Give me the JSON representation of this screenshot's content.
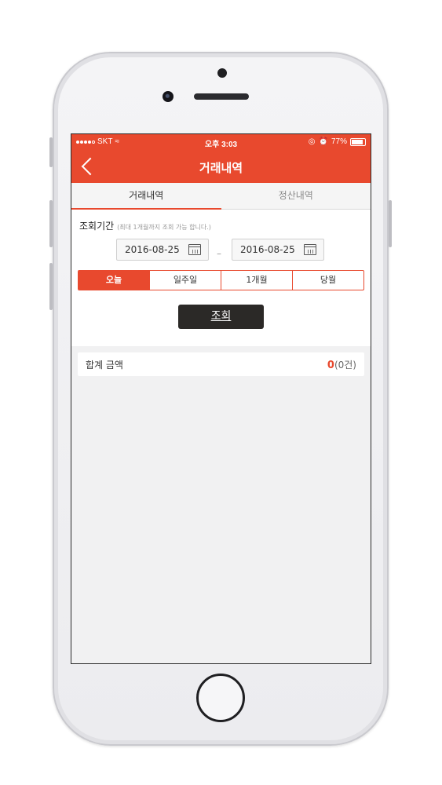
{
  "status_bar": {
    "carrier": "SKT",
    "time": "오후 3:03",
    "battery": "77%",
    "battery_fraction": 0.77
  },
  "nav": {
    "title": "거래내역",
    "back_icon": "chevron-left-icon"
  },
  "tabs": [
    {
      "label": "거래내역",
      "active": true
    },
    {
      "label": "정산내역",
      "active": false
    }
  ],
  "period": {
    "label": "조회기간",
    "note": "(최대 1개월까지 조회 가능 합니다.)",
    "start_date": "2016-08-25",
    "end_date": "2016-08-25",
    "separator": "–",
    "calendar_icon": "calendar-icon"
  },
  "quick_ranges": [
    {
      "label": "오늘",
      "active": true
    },
    {
      "label": "일주일",
      "active": false
    },
    {
      "label": "1개월",
      "active": false
    },
    {
      "label": "당월",
      "active": false
    }
  ],
  "search_button": "조회",
  "summary": {
    "label": "합계 금액",
    "amount": "0",
    "count": "(0건)"
  },
  "colors": {
    "accent": "#e8492e",
    "button_dark": "#2b2927"
  }
}
